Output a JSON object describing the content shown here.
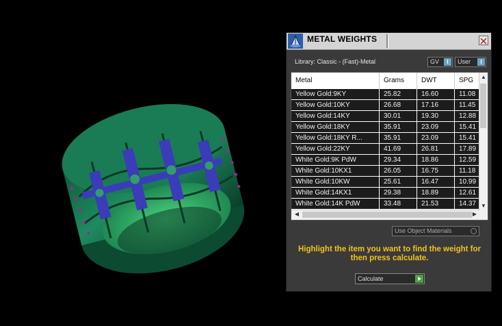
{
  "panel": {
    "title": "METAL WEIGHTS",
    "library": "Library: Classic - (Fast)-Metal",
    "gv_label": "GV",
    "user_label": "User",
    "toggle_knob": "I",
    "use_object_materials": "Use Object Materials",
    "hint": "Highlight the item you want to find the weight for then press calculate.",
    "calculate_label": "Calculate"
  },
  "table": {
    "headers": [
      "Metal",
      "Grams",
      "DWT",
      "SPG"
    ],
    "rows": [
      [
        "Yellow Gold:9KY",
        "25.82",
        "16.60",
        "11.08"
      ],
      [
        "Yellow Gold:10KY",
        "26.68",
        "17.16",
        "11.45"
      ],
      [
        "Yellow Gold:14KY",
        "30.01",
        "19.30",
        "12.88"
      ],
      [
        "Yellow Gold:18KY",
        "35.91",
        "23.09",
        "15.41"
      ],
      [
        "Yellow Gold:18KY R...",
        "35.91",
        "23.09",
        "15.41"
      ],
      [
        "Yellow Gold:22KY",
        "41.69",
        "26.81",
        "17.89"
      ],
      [
        "White Gold:9K PdW",
        "29.34",
        "18.86",
        "12.59"
      ],
      [
        "White Gold:10KX1",
        "26.05",
        "16.75",
        "11.18"
      ],
      [
        "White Gold:10KW",
        "25.61",
        "16.47",
        "10.99"
      ],
      [
        "White Gold:14KX1",
        "29.38",
        "18.89",
        "12.61"
      ],
      [
        "White Gold:14K PdW",
        "33.48",
        "21.53",
        "14.37"
      ]
    ]
  },
  "colors": {
    "hint_text": "#f2c41c",
    "ring_green": "#1f8a60",
    "gem_blue": "#3b3cb8"
  }
}
